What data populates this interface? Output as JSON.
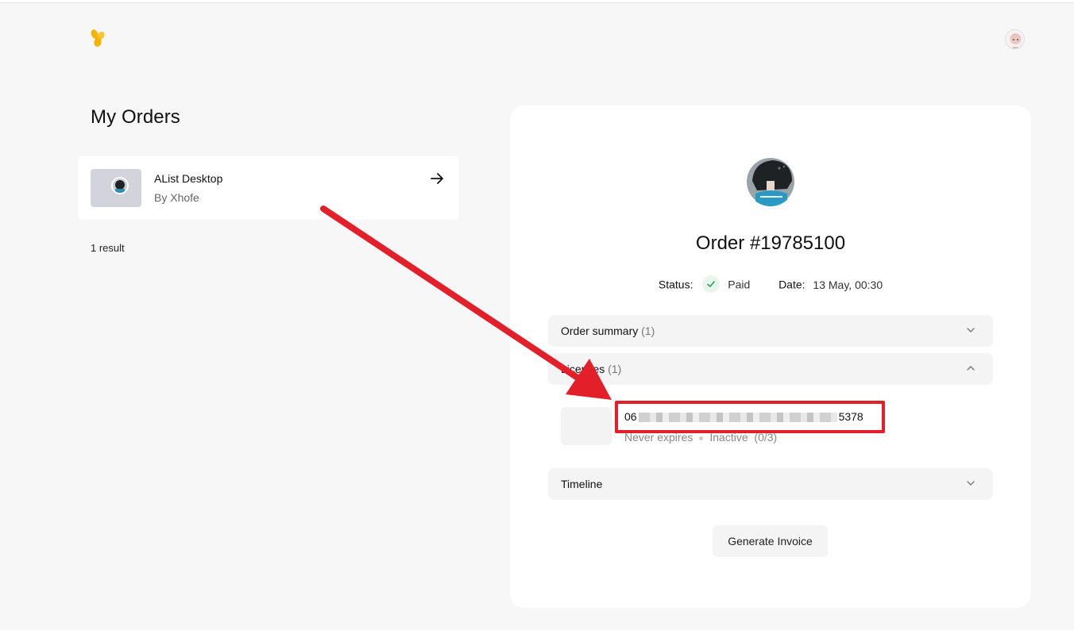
{
  "header": {
    "logo_icon": "flower-logo-icon",
    "avatar_icon": "user-avatar-icon"
  },
  "sidebar": {
    "title": "My Orders",
    "orders": [
      {
        "name": "AList Desktop",
        "seller": "By Xhofe"
      }
    ],
    "result_count": "1 result"
  },
  "detail": {
    "order_number": "Order #19785100",
    "status_label": "Status:",
    "status_value": "Paid",
    "date_label": "Date:",
    "date_value": "13 May, 00:30",
    "sections": [
      {
        "label": "Order summary",
        "count": "(1)",
        "expanded": false
      },
      {
        "label": "Licenses",
        "count": "(1)",
        "expanded": true
      },
      {
        "label": "Timeline",
        "count": "",
        "expanded": false
      }
    ],
    "license": {
      "key_prefix": "06",
      "key_suffix": "5378",
      "expiry": "Never expires",
      "status": "Inactive",
      "activations": "(0/3)"
    },
    "invoice_button": "Generate Invoice"
  },
  "colors": {
    "accent_yellow": "#f5b400",
    "paid_green": "#2e9e5b",
    "annotation_red": "#e3202a"
  }
}
